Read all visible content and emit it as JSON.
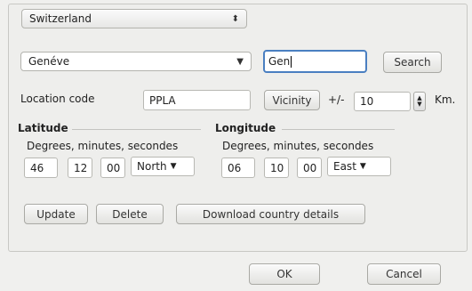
{
  "country_select": {
    "value": "Switzerland"
  },
  "city_select": {
    "value": "Genéve"
  },
  "search_input": {
    "value": "Gen"
  },
  "search_button": "Search",
  "location_code": {
    "label": "Location code",
    "value": "PPLA"
  },
  "vicinity_button": "Vicinity",
  "vicinity_plusminus": "+/-",
  "vicinity_value": "10",
  "vicinity_unit": "Km.",
  "latitude": {
    "title": "Latitude",
    "sublabel": "Degrees, minutes, secondes",
    "degrees": "46",
    "minutes": "12",
    "seconds": "00",
    "hemisphere": "North"
  },
  "longitude": {
    "title": "Longitude",
    "sublabel": "Degrees, minutes, secondes",
    "degrees": "06",
    "minutes": "10",
    "seconds": "00",
    "hemisphere": "East"
  },
  "actions": {
    "update": "Update",
    "delete": "Delete",
    "download": "Download country details"
  },
  "dialog": {
    "ok": "OK",
    "cancel": "Cancel"
  },
  "icons": {
    "updown": "up-down-arrows-icon",
    "dropdown": "chevron-down-icon"
  }
}
